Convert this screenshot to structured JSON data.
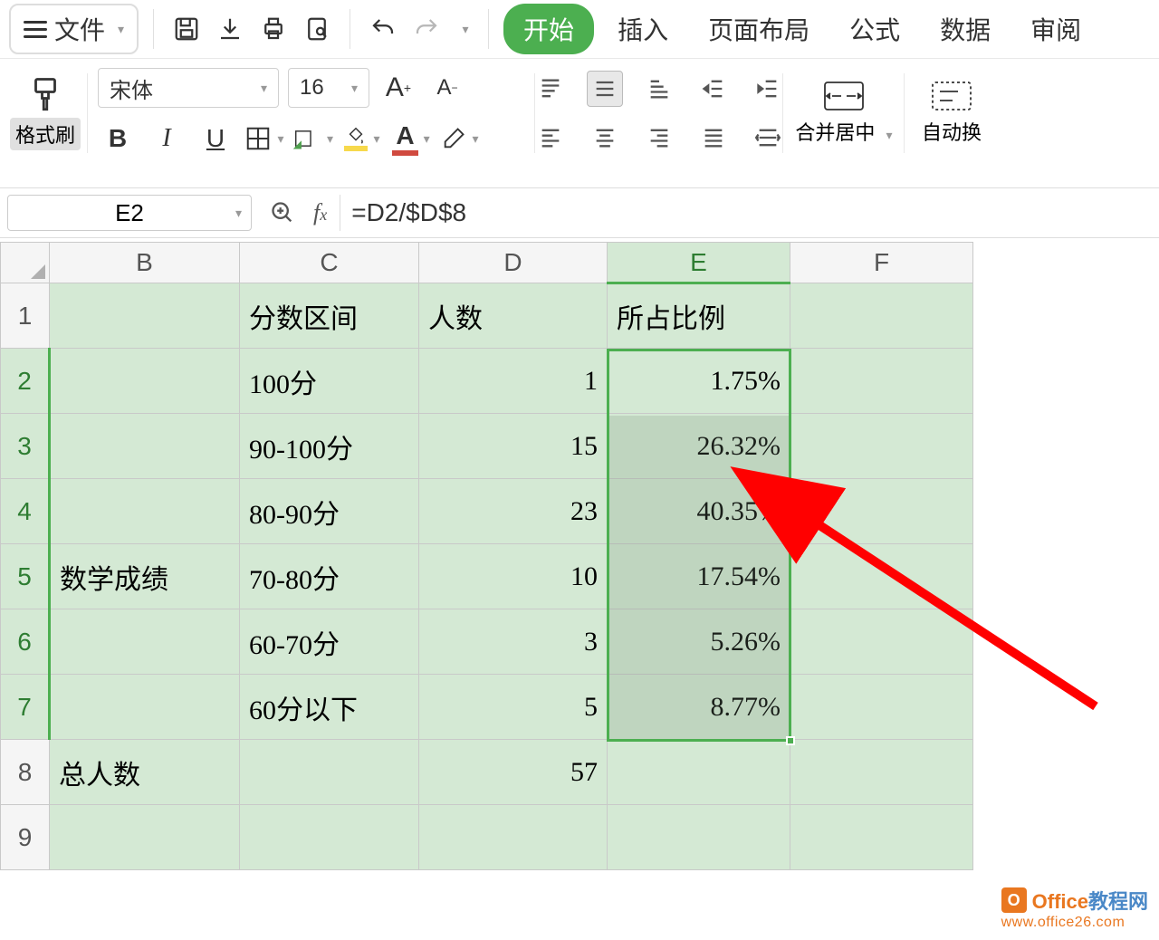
{
  "menu": {
    "file": "文件",
    "tabs": [
      "开始",
      "插入",
      "页面布局",
      "公式",
      "数据",
      "审阅"
    ]
  },
  "format_painter_label": "格式刷",
  "font": {
    "name": "宋体",
    "size": "16"
  },
  "merge_label": "合并居中",
  "wrap_label": "自动换",
  "name_box": "E2",
  "formula": "=D2/$D$8",
  "columns": [
    "B",
    "C",
    "D",
    "E",
    "F"
  ],
  "rows": [
    "1",
    "2",
    "3",
    "4",
    "5",
    "6",
    "7",
    "8",
    "9"
  ],
  "headers": {
    "c1": "分数区间",
    "d1": "人数",
    "e1": "所占比例"
  },
  "data": {
    "b5": "数学成绩",
    "rows": [
      {
        "range": "100分",
        "count": "1",
        "pct": "1.75%"
      },
      {
        "range": "90-100分",
        "count": "15",
        "pct": "26.32%"
      },
      {
        "range": "80-90分",
        "count": "23",
        "pct": "40.35%"
      },
      {
        "range": "70-80分",
        "count": "10",
        "pct": "17.54%"
      },
      {
        "range": "60-70分",
        "count": "3",
        "pct": "5.26%"
      },
      {
        "range": "60分以下",
        "count": "5",
        "pct": "8.77%"
      }
    ],
    "total_label": "总人数",
    "total_count": "57"
  },
  "watermark": {
    "brand_strong": "Office",
    "brand_rest": "教程网",
    "url": "www.office26.com"
  }
}
